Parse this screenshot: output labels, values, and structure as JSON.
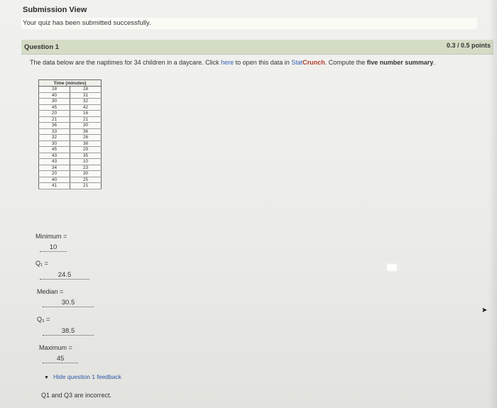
{
  "page": {
    "title": "Submission View",
    "success_message": "Your quiz has been submitted successfully."
  },
  "question": {
    "title": "Question 1",
    "points": "0.3 / 0.5 points",
    "prompt_start": "The data below are the naptimes for 34 children in a daycare. Click ",
    "prompt_link": "here",
    "prompt_middle": " to open this data in ",
    "prompt_brand_prefix": "Stat",
    "prompt_brand_suffix": "Crunch",
    "prompt_end": ". Compute the ",
    "prompt_bold": "five number summary",
    "prompt_period": "."
  },
  "table": {
    "header": "Time (minutes)",
    "rows": [
      [
        "28",
        "28"
      ],
      [
        "40",
        "31"
      ],
      [
        "30",
        "32"
      ],
      [
        "45",
        "42"
      ],
      [
        "20",
        "16"
      ],
      [
        "21",
        "21"
      ],
      [
        "36",
        "30"
      ],
      [
        "33",
        "36"
      ],
      [
        "32",
        "26"
      ],
      [
        "30",
        "38"
      ],
      [
        "45",
        "29"
      ],
      [
        "43",
        "35"
      ],
      [
        "43",
        "10"
      ],
      [
        "34",
        "23"
      ],
      [
        "20",
        "30"
      ],
      [
        "40",
        "25"
      ],
      [
        "41",
        "21"
      ]
    ]
  },
  "answers": {
    "minimum_label": "Minimum =",
    "minimum_value": "10",
    "q1_label": "Q₁ =",
    "q1_value": "24.5",
    "median_label": "Median =",
    "median_value": "30.5",
    "q3_label": "Q₃ =",
    "q3_value": "38.5",
    "maximum_label": "Maximum =",
    "maximum_value": "45"
  },
  "feedback": {
    "toggle_label": "Hide question 1 feedback",
    "toggle_icon": "triangle-down-icon",
    "text": "Q1 and Q3 are incorrect."
  }
}
